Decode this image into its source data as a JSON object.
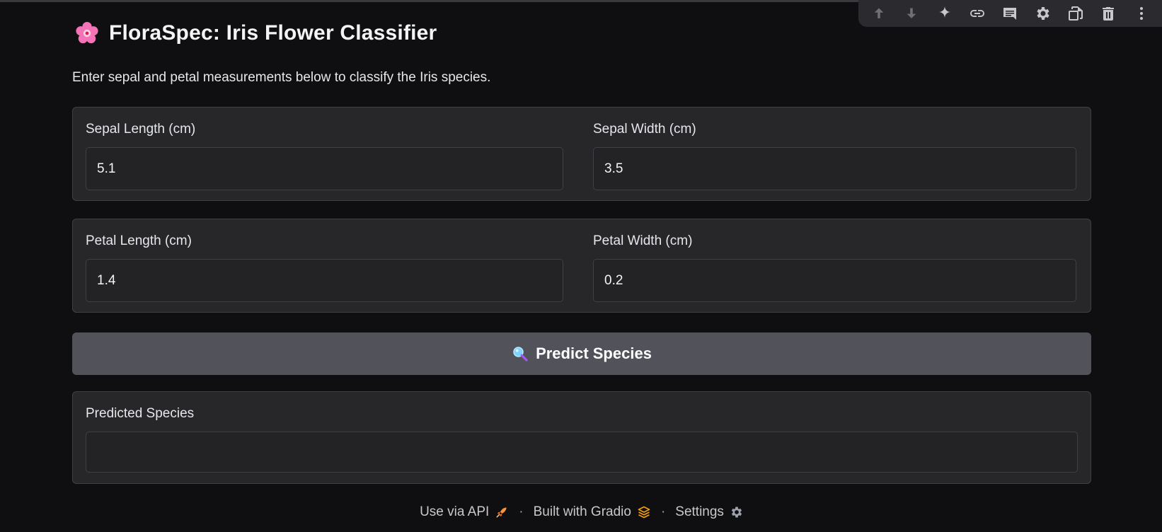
{
  "app": {
    "title": "FloraSpec: Iris Flower Classifier",
    "subtitle": "Enter sepal and petal measurements below to classify the Iris species."
  },
  "inputs": {
    "sepal_length": {
      "label": "Sepal Length (cm)",
      "value": "5.1"
    },
    "sepal_width": {
      "label": "Sepal Width (cm)",
      "value": "3.5"
    },
    "petal_length": {
      "label": "Petal Length (cm)",
      "value": "1.4"
    },
    "petal_width": {
      "label": "Petal Width (cm)",
      "value": "0.2"
    }
  },
  "predict_button": {
    "label": "Predict Species",
    "icon": "magnifier-icon"
  },
  "output": {
    "label": "Predicted Species",
    "value": ""
  },
  "footer": {
    "api_label": "Use via API",
    "gradio_label": "Built with Gradio",
    "settings_label": "Settings",
    "separator": "·"
  },
  "toolbar": {
    "icons": [
      "arrow-up-icon",
      "arrow-down-icon",
      "sparkle-icon",
      "link-icon",
      "comment-icon",
      "gear-icon",
      "duplicate-icon",
      "trash-icon",
      "more-vert-icon"
    ]
  },
  "colors": {
    "background": "#0f0f11",
    "panel": "#27272a",
    "button": "#52525b",
    "flower": "#f472b6"
  }
}
